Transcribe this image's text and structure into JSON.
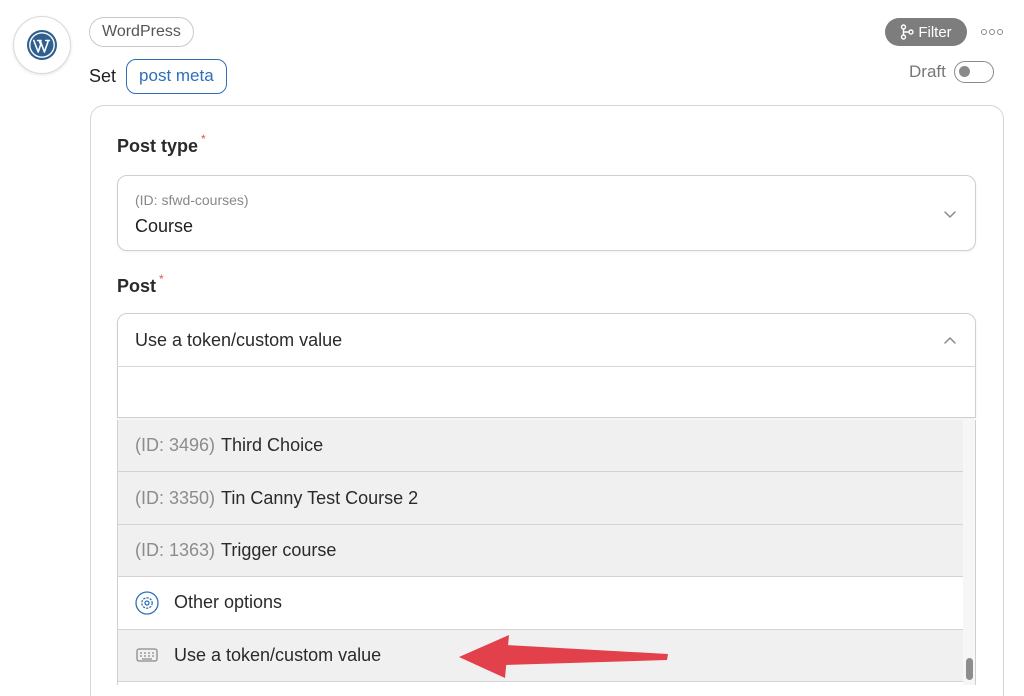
{
  "header": {
    "integration": "WordPress",
    "action_prefix": "Set",
    "action_token": "post meta",
    "filter_label": "Filter",
    "status_label": "Draft"
  },
  "fields": {
    "post_type": {
      "label": "Post type",
      "required_mark": "*",
      "value_id": "(ID: sfwd-courses)",
      "value": "Course"
    },
    "post": {
      "label": "Post",
      "required_mark": "*",
      "value": "Use a token/custom value",
      "search_value": "",
      "options": [
        {
          "id": "(ID: 3496)",
          "label": "Third Choice"
        },
        {
          "id": "(ID: 3350)",
          "label": "Tin Canny Test Course 2"
        },
        {
          "id": "(ID: 1363)",
          "label": "Trigger course"
        }
      ],
      "other_options_label": "Other options",
      "token_option_label": "Use a token/custom value"
    }
  },
  "icons": {
    "logo": "wordpress-logo-icon",
    "filter": "filter-branch-icon",
    "more": "more-dots-icon",
    "other": "gear-icon",
    "token": "keyboard-icon",
    "arrow": "red-arrow-annotation"
  },
  "colors": {
    "accent": "#2e70b8",
    "filter_bg": "#7d7d7d",
    "arrow": "#e2404a",
    "required": "#e05454"
  },
  "toggle": {
    "on": false
  }
}
